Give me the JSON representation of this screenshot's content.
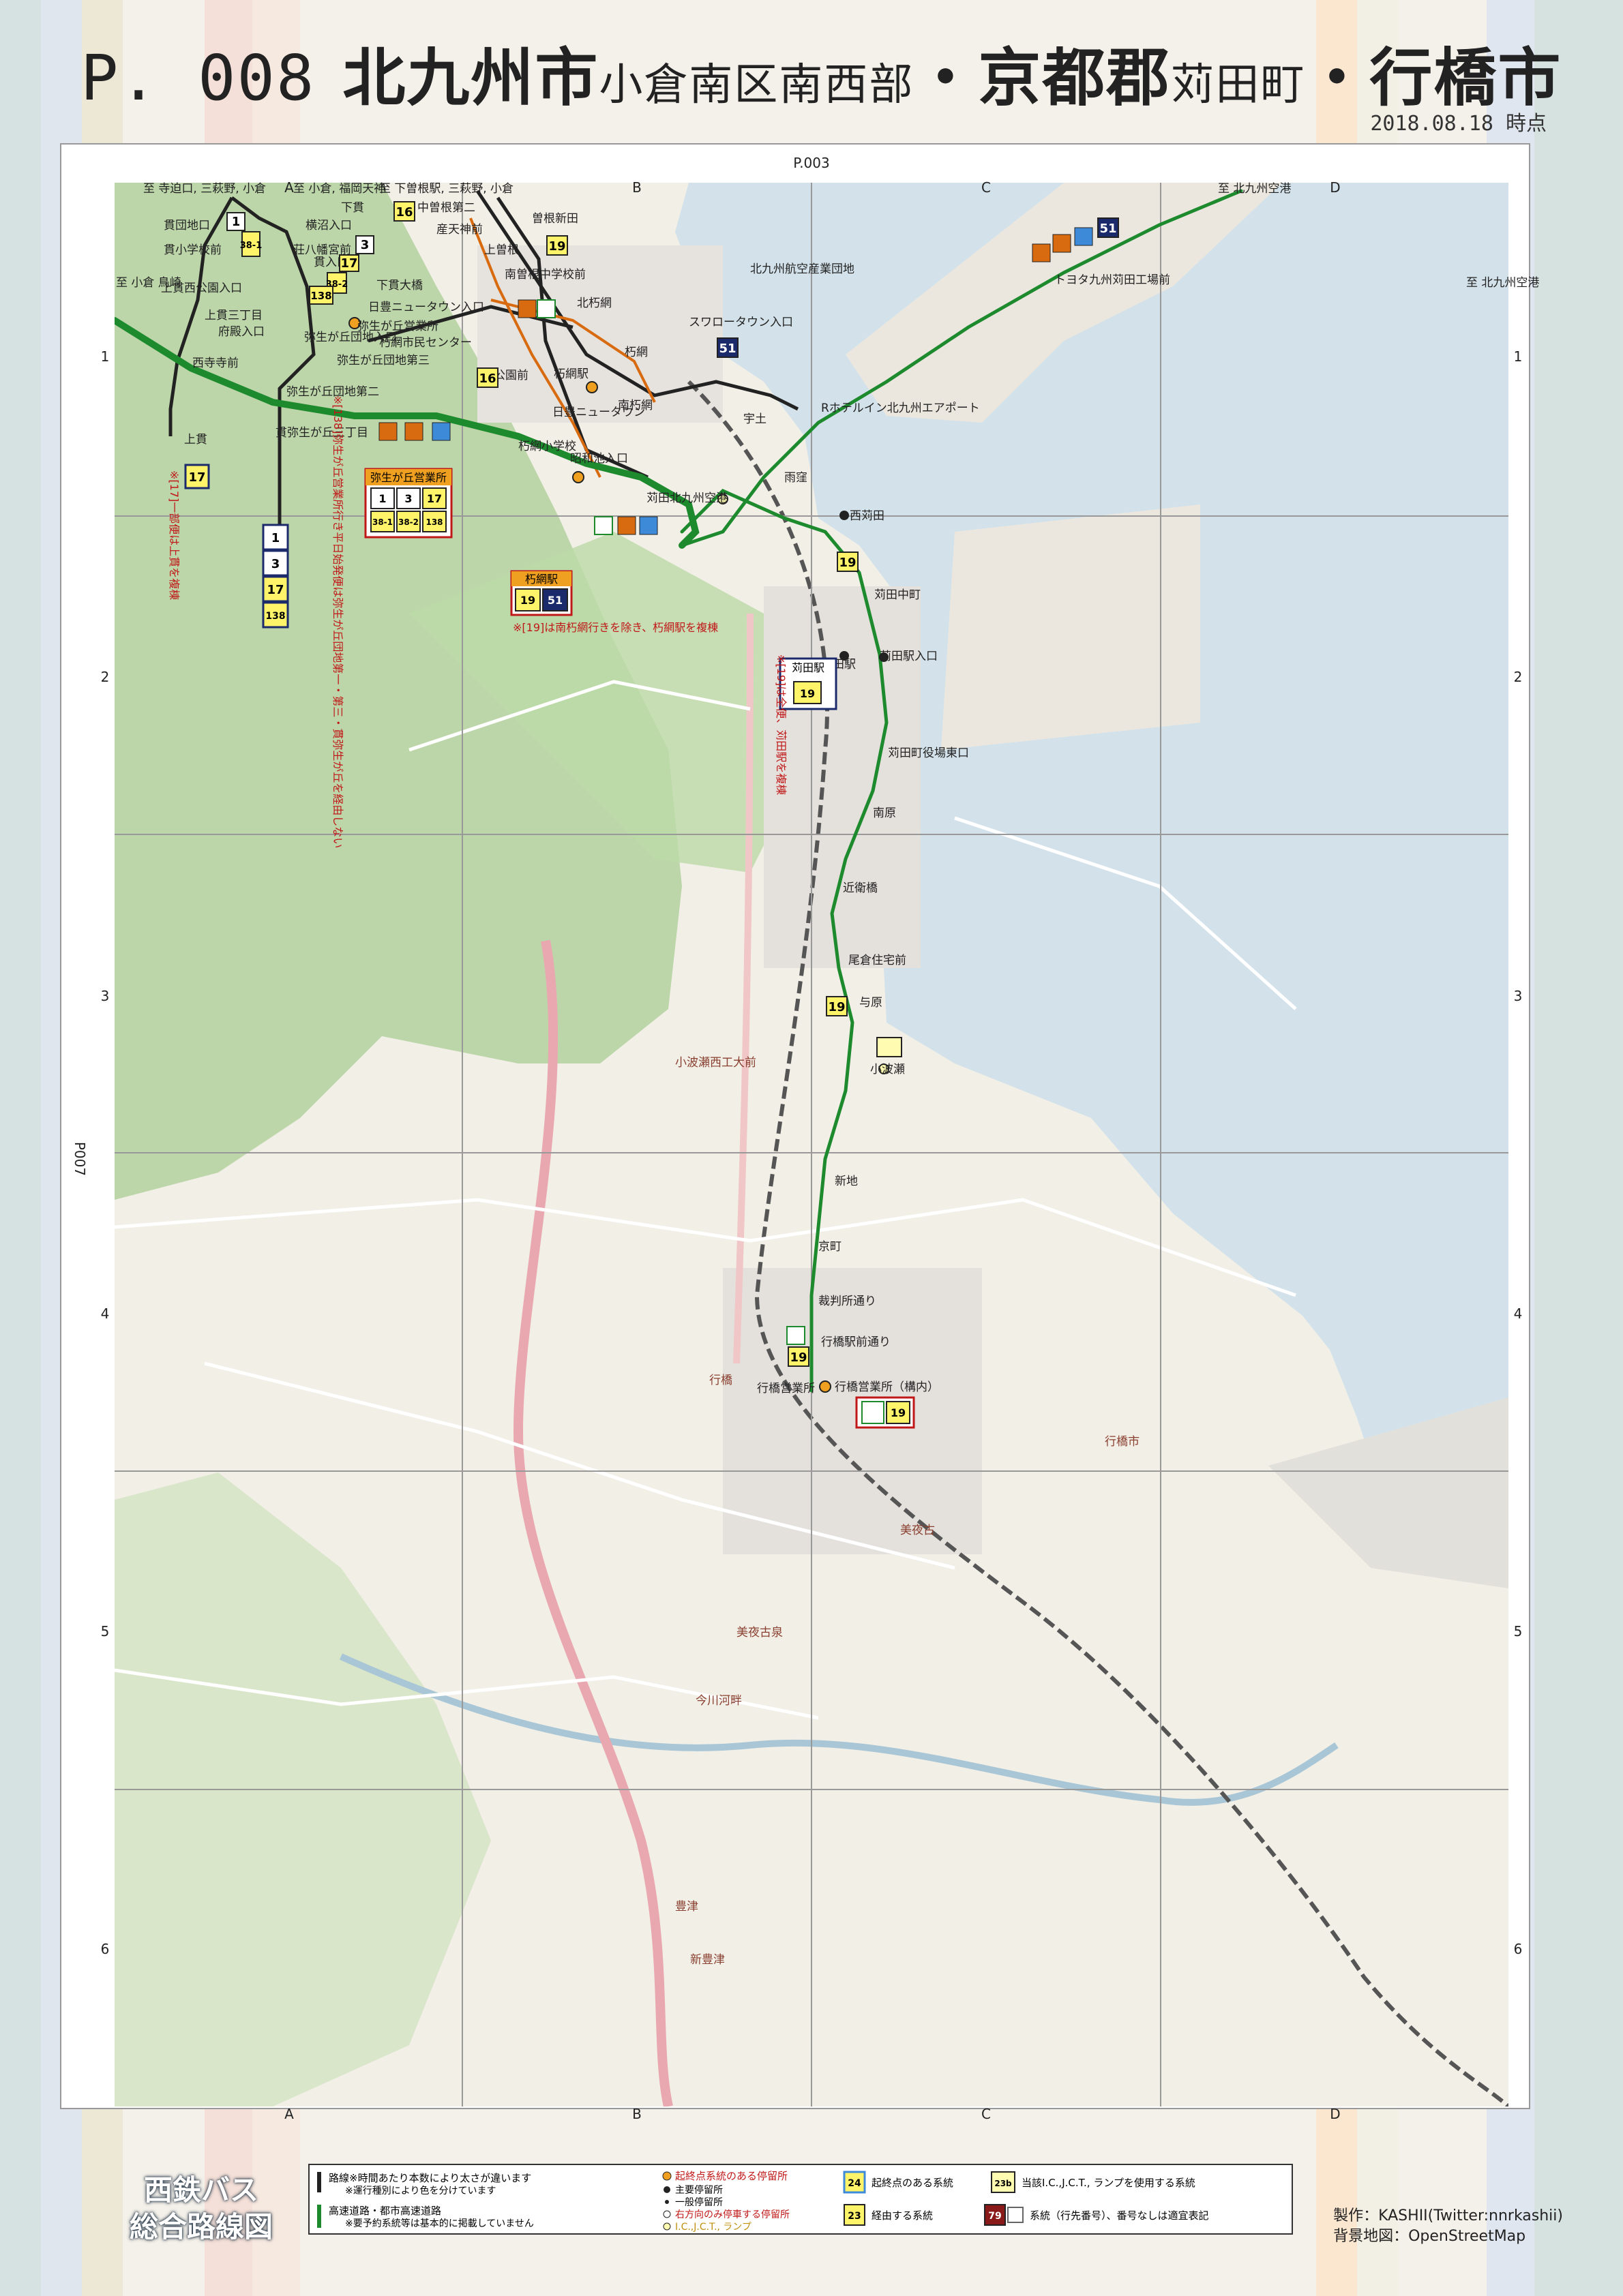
{
  "header": {
    "page_no": "P. 008",
    "title_a": "北九州市",
    "title_b": "小倉南区南西部",
    "title_c": "・京都郡",
    "title_d": "苅田町",
    "title_e": "・行橋市",
    "date": "2018.08.18 時点"
  },
  "grid": {
    "cols": [
      "A",
      "B",
      "C",
      "D"
    ],
    "rows": [
      "1",
      "2",
      "3",
      "4",
      "5",
      "6"
    ],
    "ref_top": "P.003",
    "ref_left": "P007"
  },
  "edge_labels": {
    "top": [
      "至 寺迫口, 三萩野, 小倉",
      "至 小倉, 福岡天神",
      "至 下曽根駅, 三萩野, 小倉",
      "至 北九州空港"
    ],
    "left": "至 小倉 鳥崎",
    "right": "至 北九州空港"
  },
  "stops": {
    "kinuki_north": [
      "貫団地口",
      "貫小学校前",
      "上貫西公園入口",
      "上貫三丁目",
      "府殿入口",
      "西寺寺前"
    ],
    "yayoi": [
      "横沼入口",
      "荘八幡宮前",
      "貫入口",
      "下貫",
      "下貫大橋",
      "弥生が丘団地入口",
      "弥生が丘団地第二",
      "弥生が丘団地第三",
      "貫弥生が丘三丁目",
      "上貫"
    ],
    "kusami": [
      "中曽根第二",
      "産天神前",
      "曽根新田",
      "上曽根",
      "南曽根中学校前",
      "北朽網",
      "朽網市民センター",
      "日豊ニュータウン入口",
      "公園前",
      "朽網小学校",
      "日豊ニュータウン",
      "朽網駅",
      "南朽網",
      "朽網",
      "昭和池入口",
      "弥生が丘営業所"
    ],
    "kanda": [
      "スワロータウン入口",
      "北九州航空産業団地",
      "宇土",
      "雨窪",
      "苅田北九州空港",
      "Rホテルイン北九州エアポート",
      "トヨタ九州苅田工場前",
      "西苅田",
      "苅田中町",
      "苅田駅入口",
      "苅田駅",
      "苅田町役場東口",
      "南原",
      "近衛橋",
      "尾倉住宅前",
      "与原",
      "小波瀬"
    ],
    "yukuhashi": [
      "新地",
      "京町",
      "裁判所通り",
      "行橋駅前通り",
      "行橋営業所",
      "行橋営業所（構内）"
    ]
  },
  "routes": {
    "r1": "1",
    "r3": "3",
    "r16": "16",
    "r17": "17",
    "r19": "19",
    "r38_1": "38-1",
    "r38_2": "38-2",
    "r51": "51",
    "r138": "138"
  },
  "notes": {
    "n1": "※[17]一部便は上貫を複棟",
    "n2": "※[138]弥生が丘営業所行き平日始発便は弥生が丘団地第一・第三・貫弥生が丘を経由しない",
    "n3": "※[19]は南朽網行きを除き、朽網駅を複棟",
    "n4": "※[19]は全便、苅田駅を複棟",
    "box_yayoi": "弥生が丘営業所",
    "box_kusami": "朽網駅",
    "box_kanda": "苅田駅"
  },
  "map_places": {
    "p1": "小波瀬西工大前",
    "p2": "行橋",
    "p3": "行橋市",
    "p4": "今川河畔",
    "p5": "美夜古泉",
    "p6": "豊津",
    "p7": "新豊津",
    "p8": "美夜古"
  },
  "legend": {
    "l1": "路線※時間あたり本数により太さが違います",
    "l2": "※運行種別により色を分けています",
    "l3": "高速道路・都市高速道路",
    "l4": "※要予約系統等は基本的に掲載していません",
    "l5": "起終点系統のある停留所",
    "l6": "主要停留所",
    "l7": "一般停留所",
    "l8": "右方向のみ停車する停留所",
    "l9": "I.C.,J.C.T., ランプ",
    "s1": "24",
    "s1_label": "起終点のある系統",
    "s2": "23",
    "s2_label": "経由する系統",
    "s3": "23b",
    "s3_label": "当該I.C.,J.C.T., ランプを使用する系統",
    "s4": "79",
    "s4_label": "系統（行先番号）、番号なしは適宜表記"
  },
  "brand": {
    "line1": "西鉄バス",
    "line2": "総合路線図"
  },
  "credit": {
    "line1": "製作：KASHII(Twitter:nnrkashii)",
    "line2": "背景地図：OpenStreetMap"
  },
  "colors": {
    "green_route": "#1e8a2e",
    "black_route": "#222222",
    "orange_route": "#d86a10",
    "sea": "#d3e2ea",
    "forest": "#aecf9a"
  }
}
